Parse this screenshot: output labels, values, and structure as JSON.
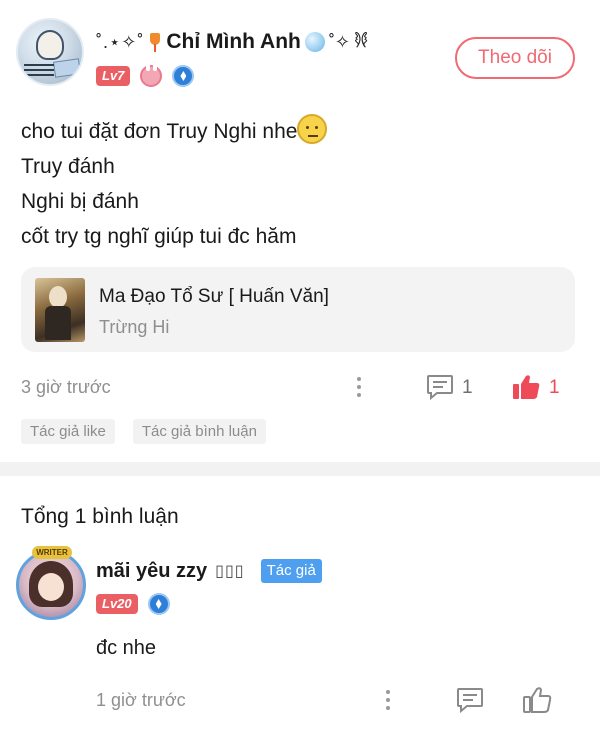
{
  "post": {
    "author": {
      "prefix_deco": "˚.⋆✧˚",
      "name": "Chỉ Mình Anh",
      "suffix_deco": "˚✧",
      "swirl": "𐦍",
      "level": "Lv7"
    },
    "follow_label": "Theo dõi",
    "lines": [
      "cho tui đặt đơn Truy Nghi nhe",
      "Truy đánh",
      "Nghi bị đánh",
      "cốt try tg nghĩ giúp tui đc hăm"
    ],
    "book": {
      "title": "Ma Đạo Tổ Sư [ Huấn Văn]",
      "author": "Trừng Hi"
    },
    "time": "3 giờ trước",
    "comment_count": "1",
    "like_count": "1",
    "tags": [
      "Tác giả like",
      "Tác giả bình luận"
    ],
    "colors": {
      "accent": "#ef6a73",
      "like": "#ee4a57",
      "level": "#e95f63"
    }
  },
  "comments": {
    "title": "Tổng 1 bình luận",
    "items": [
      {
        "avatar_tag": "WRITER",
        "name": "mãi yêu zzy",
        "name_glyphs": "▯▯▯",
        "author_badge": "Tác giả",
        "level": "Lv20",
        "text": "đc nhe",
        "time": "1 giờ trước"
      }
    ]
  },
  "icons": {
    "post": [
      "drink-icon",
      "bubble-icon",
      "bunny-icon",
      "shield-icon",
      "more-icon",
      "comment-icon",
      "thumb-up-icon"
    ],
    "comment": [
      "shield-icon",
      "more-icon",
      "comment-icon",
      "thumb-up-icon"
    ]
  }
}
